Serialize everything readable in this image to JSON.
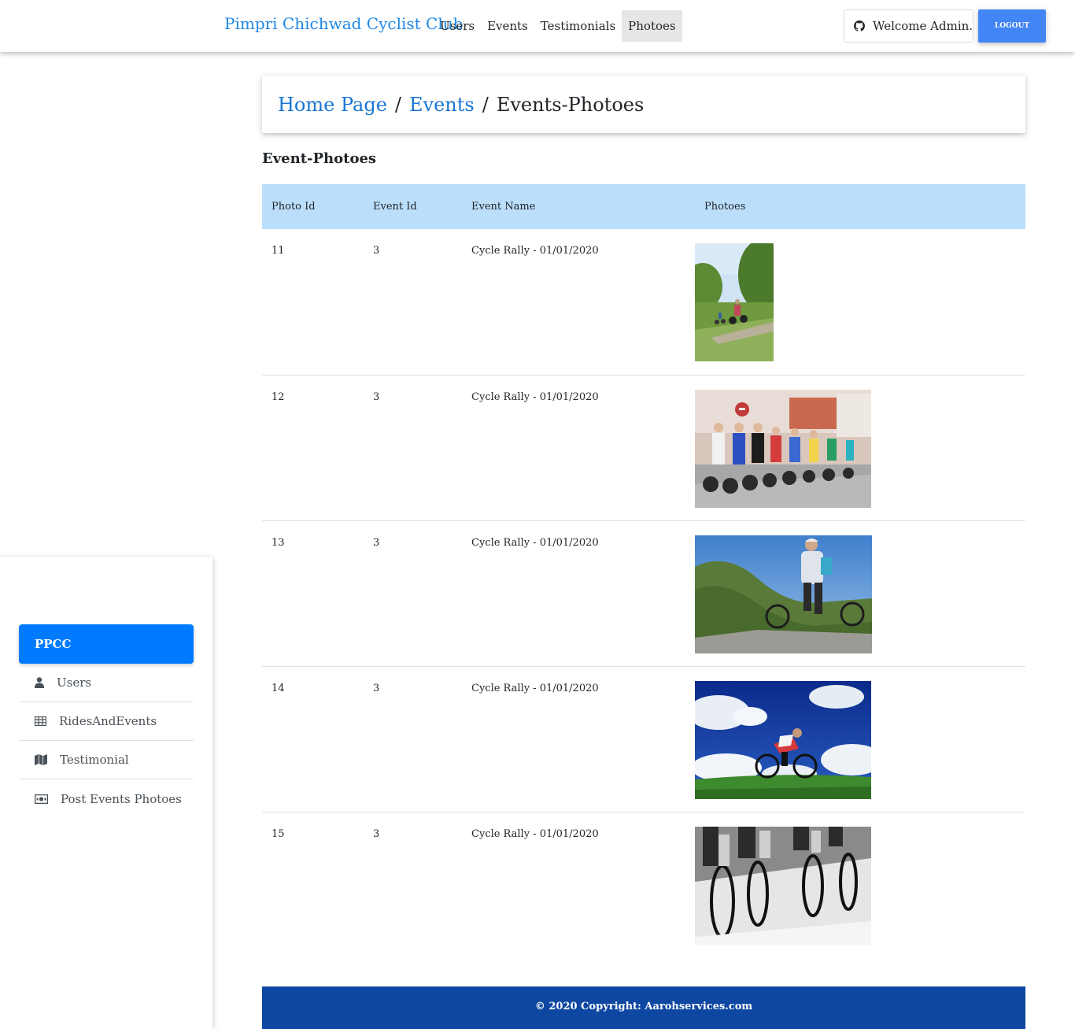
{
  "navbar": {
    "brand": "Pimpri Chichwad Cyclist Club",
    "links": [
      "Users",
      "Events",
      "Testimonials",
      "Photoes"
    ],
    "active_link": "Photoes",
    "welcome": "Welcome Admin..",
    "logout": "LOGOUT",
    "accent": "#4285f4"
  },
  "sidebar": {
    "brand": "PPCC",
    "items": [
      {
        "label": "Users",
        "icon": "user-icon"
      },
      {
        "label": "RidesAndEvents",
        "icon": "table-icon"
      },
      {
        "label": "Testimonial",
        "icon": "map-icon"
      },
      {
        "label": "Post Events Photoes",
        "icon": "money-bill-icon"
      }
    ]
  },
  "breadcrumb": {
    "home": "Home Page",
    "events": "Events",
    "current": "Events-Photoes",
    "separator": "/"
  },
  "section_title": "Event-Photoes",
  "table": {
    "headers": [
      "Photo Id",
      "Event Id",
      "Event Name",
      "Photoes"
    ],
    "rows": [
      {
        "photo_id": "11",
        "event_id": "3",
        "event_name": "Cycle Rally - 01/01/2020",
        "photo": "mountain-bikers-on-grass-trail"
      },
      {
        "photo_id": "12",
        "event_id": "3",
        "event_name": "Cycle Rally - 01/01/2020",
        "photo": "road-race-peloton"
      },
      {
        "photo_id": "13",
        "event_id": "3",
        "event_name": "Cycle Rally - 01/01/2020",
        "photo": "cyclist-on-mountain-rock"
      },
      {
        "photo_id": "14",
        "event_id": "3",
        "event_name": "Cycle Rally - 01/01/2020",
        "photo": "cyclist-under-blue-sky"
      },
      {
        "photo_id": "15",
        "event_id": "3",
        "event_name": "Cycle Rally - 01/01/2020",
        "photo": "black-and-white-wheels"
      }
    ]
  },
  "footer": "© 2020 Copyright: Aarohservices.com",
  "colors": {
    "header_row": "#bbdefb",
    "footer": "#0d47a1",
    "sidebar_brand": "#007bff",
    "brand_text": "#1e88e5"
  }
}
